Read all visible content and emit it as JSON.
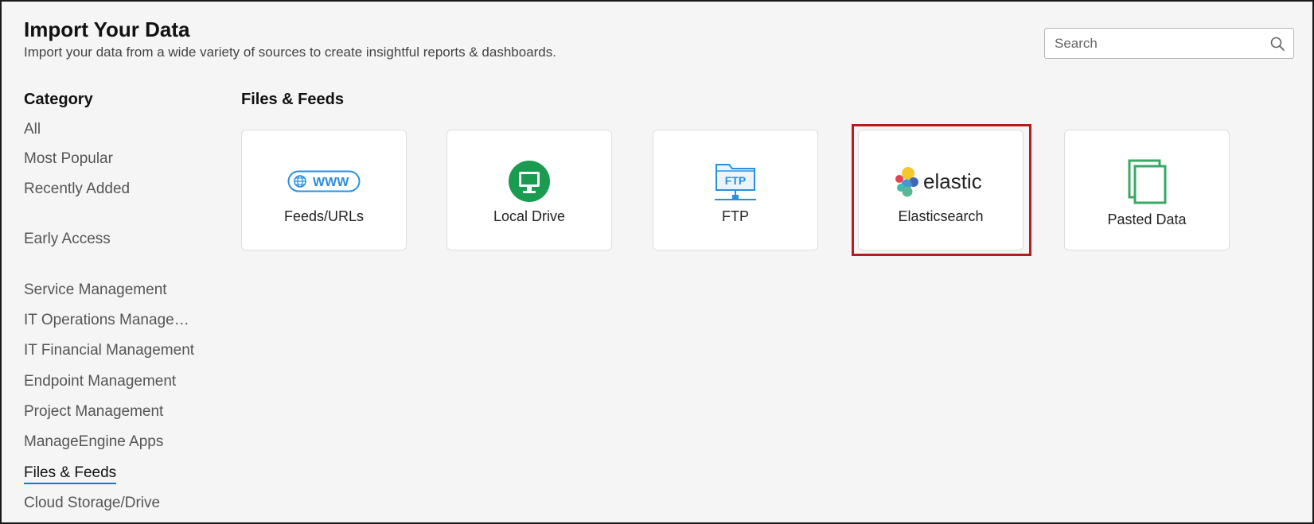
{
  "header": {
    "title": "Import Your Data",
    "subtitle": "Import your data from a wide variety of sources to create insightful reports & dashboards."
  },
  "search": {
    "placeholder": "Search",
    "icon": "search-icon"
  },
  "sidebar": {
    "heading": "Category",
    "items": [
      {
        "label": "All",
        "active": false
      },
      {
        "label": "Most Popular",
        "active": false
      },
      {
        "label": "Recently Added",
        "active": false
      },
      {
        "label": "Early Access",
        "active": false
      },
      {
        "label": "Service Management",
        "active": false
      },
      {
        "label": "IT Operations Manage…",
        "active": false
      },
      {
        "label": "IT Financial Management",
        "active": false
      },
      {
        "label": "Endpoint Management",
        "active": false
      },
      {
        "label": "Project Management",
        "active": false
      },
      {
        "label": "ManageEngine Apps",
        "active": false
      },
      {
        "label": "Files & Feeds",
        "active": true
      },
      {
        "label": "Cloud Storage/Drive",
        "active": false
      }
    ]
  },
  "main": {
    "heading": "Files & Feeds",
    "cards": [
      {
        "label": "Feeds/URLs",
        "icon": "www-icon",
        "icon_text": "WWW"
      },
      {
        "label": "Local Drive",
        "icon": "local-drive-icon"
      },
      {
        "label": "FTP",
        "icon": "ftp-icon",
        "icon_text": "FTP"
      },
      {
        "label": "Elasticsearch",
        "icon": "elastic-logo",
        "icon_text": "elastic",
        "highlighted": true
      },
      {
        "label": "Pasted Data",
        "icon": "pasted-data-icon"
      }
    ]
  },
  "colors": {
    "accent": "#1976d2",
    "highlight": "#b71c1c",
    "local_drive_green": "#1a9b50",
    "pasted_green": "#3aa864",
    "ftp_blue": "#2a8fe0"
  }
}
